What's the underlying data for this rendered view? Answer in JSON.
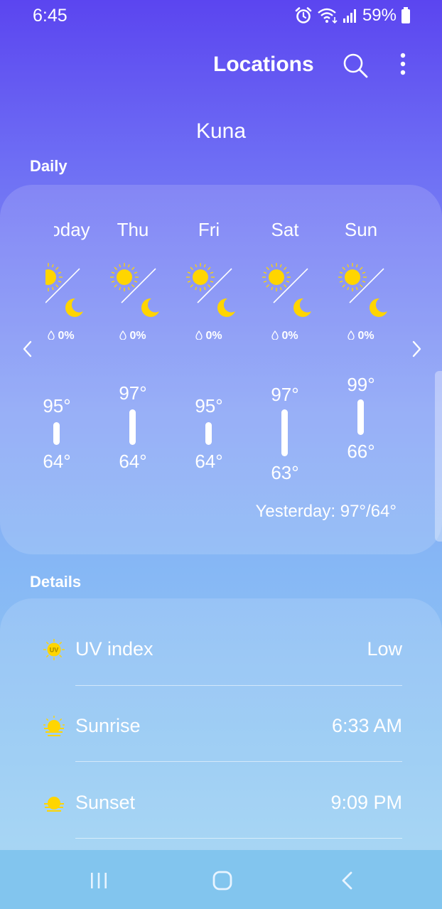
{
  "status_bar": {
    "time": "6:45",
    "battery": "59%",
    "icons": [
      "alarm-icon",
      "wifi-icon",
      "signal-icon",
      "battery-icon"
    ]
  },
  "appbar": {
    "title": "Locations",
    "icons": [
      "search-icon",
      "more-vert-icon"
    ]
  },
  "location": {
    "name": "Kuna"
  },
  "daily": {
    "label": "Daily",
    "days": [
      {
        "name": "Today",
        "precip": "0%",
        "high": "95°",
        "low": "64°"
      },
      {
        "name": "Thu",
        "precip": "0%",
        "high": "97°",
        "low": "64°"
      },
      {
        "name": "Fri",
        "precip": "0%",
        "high": "95°",
        "low": "64°"
      },
      {
        "name": "Sat",
        "precip": "0%",
        "high": "97°",
        "low": "63°"
      },
      {
        "name": "Sun",
        "precip": "0%",
        "high": "99°",
        "low": "66°"
      }
    ],
    "yesterday": "Yesterday: 97°/64°"
  },
  "details": {
    "label": "Details",
    "rows": [
      {
        "label": "UV index",
        "value": "Low",
        "icon": "uv-index-icon"
      },
      {
        "label": "Sunrise",
        "value": "6:33 AM",
        "icon": "sunrise-icon"
      },
      {
        "label": "Sunset",
        "value": "9:09 PM",
        "icon": "sunset-icon"
      }
    ]
  },
  "colors": {
    "sun": "#ffd500",
    "gradient_top": "#5b45f0",
    "gradient_bottom": "#9fd3f2",
    "navbar": "#82c5ee"
  }
}
